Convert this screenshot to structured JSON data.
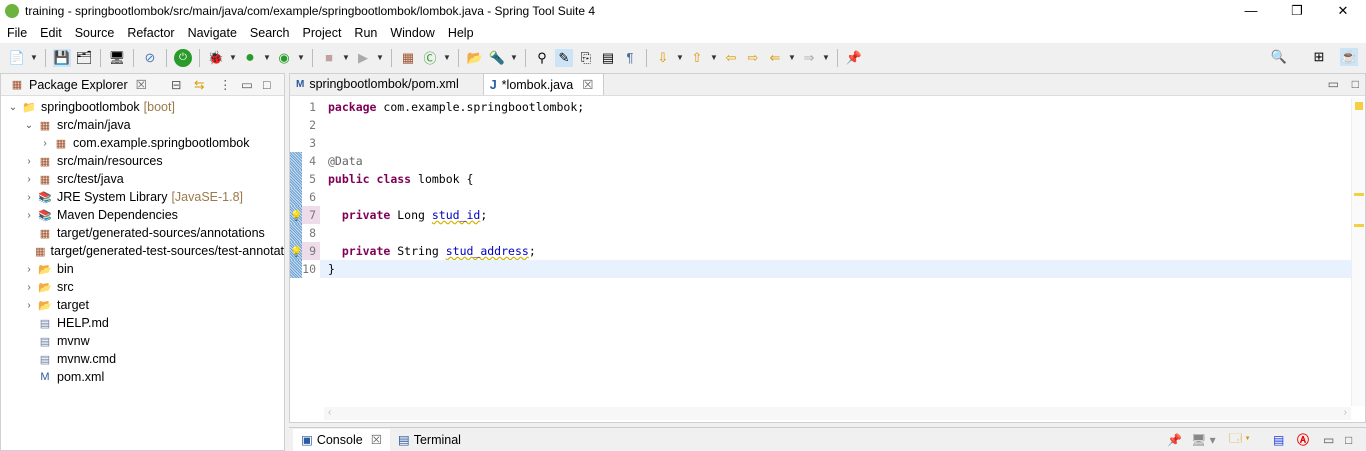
{
  "window": {
    "title": "training - springbootlombok/src/main/java/com/example/springbootlombok/lombok.java - Spring Tool Suite 4",
    "minimize": "—",
    "maximize": "❐",
    "close": "✕"
  },
  "menu": [
    "File",
    "Edit",
    "Source",
    "Refactor",
    "Navigate",
    "Search",
    "Project",
    "Run",
    "Window",
    "Help"
  ],
  "package_explorer": {
    "title": "Package Explorer",
    "items": [
      {
        "label": "springbootlombok",
        "decoration": "[boot]",
        "depth": 0,
        "twisty": "open",
        "icon": "project-icon"
      },
      {
        "label": "src/main/java",
        "depth": 1,
        "twisty": "open",
        "icon": "source-folder-icon"
      },
      {
        "label": "com.example.springbootlombok",
        "depth": 2,
        "twisty": "closed",
        "icon": "package-icon"
      },
      {
        "label": "src/main/resources",
        "depth": 1,
        "twisty": "closed",
        "icon": "source-folder-icon"
      },
      {
        "label": "src/test/java",
        "depth": 1,
        "twisty": "closed",
        "icon": "source-folder-icon"
      },
      {
        "label": "JRE System Library",
        "decoration": "[JavaSE-1.8]",
        "depth": 1,
        "twisty": "closed",
        "icon": "library-icon"
      },
      {
        "label": "Maven Dependencies",
        "depth": 1,
        "twisty": "closed",
        "icon": "library-icon"
      },
      {
        "label": "target/generated-sources/annotations",
        "depth": 1,
        "twisty": "none",
        "icon": "source-folder-icon"
      },
      {
        "label": "target/generated-test-sources/test-annotat",
        "depth": 1,
        "twisty": "none",
        "icon": "source-folder-icon"
      },
      {
        "label": "bin",
        "depth": 1,
        "twisty": "closed",
        "icon": "folder-icon"
      },
      {
        "label": "src",
        "depth": 1,
        "twisty": "closed",
        "icon": "folder-icon"
      },
      {
        "label": "target",
        "depth": 1,
        "twisty": "closed",
        "icon": "folder-icon"
      },
      {
        "label": "HELP.md",
        "depth": 1,
        "twisty": "none",
        "icon": "file-icon"
      },
      {
        "label": "mvnw",
        "depth": 1,
        "twisty": "none",
        "icon": "file-icon"
      },
      {
        "label": "mvnw.cmd",
        "depth": 1,
        "twisty": "none",
        "icon": "file-icon"
      },
      {
        "label": "pom.xml",
        "depth": 1,
        "twisty": "none",
        "icon": "maven-file-icon"
      }
    ]
  },
  "editor": {
    "tabs": [
      {
        "label": "springbootlombok/pom.xml",
        "active": false
      },
      {
        "label": "*lombok.java",
        "active": true
      }
    ],
    "lines": [
      {
        "n": "1",
        "tokens": [
          {
            "t": "package",
            "c": "kw"
          },
          {
            "t": " com.example.springbootlombok;",
            "c": ""
          }
        ]
      },
      {
        "n": "2",
        "tokens": []
      },
      {
        "n": "3",
        "tokens": []
      },
      {
        "n": "4",
        "tokens": [
          {
            "t": "@Data",
            "c": "ann"
          }
        ]
      },
      {
        "n": "5",
        "tokens": [
          {
            "t": "public",
            "c": "kw"
          },
          {
            "t": " ",
            "c": ""
          },
          {
            "t": "class",
            "c": "kw"
          },
          {
            "t": " lombok {",
            "c": ""
          }
        ]
      },
      {
        "n": "6",
        "tokens": []
      },
      {
        "n": "7",
        "tokens": [
          {
            "t": "  ",
            "c": ""
          },
          {
            "t": "private",
            "c": "kw"
          },
          {
            "t": " Long ",
            "c": ""
          },
          {
            "t": "stud_id",
            "c": "fld"
          },
          {
            "t": ";",
            "c": ""
          }
        ]
      },
      {
        "n": "8",
        "tokens": []
      },
      {
        "n": "9",
        "tokens": [
          {
            "t": "  ",
            "c": ""
          },
          {
            "t": "private",
            "c": "kw"
          },
          {
            "t": " String ",
            "c": ""
          },
          {
            "t": "stud_address",
            "c": "fld"
          },
          {
            "t": ";",
            "c": ""
          }
        ]
      },
      {
        "n": "10",
        "tokens": [
          {
            "t": "}",
            "c": ""
          }
        ]
      }
    ]
  },
  "bottom": {
    "tabs": [
      "Console",
      "Terminal"
    ]
  }
}
